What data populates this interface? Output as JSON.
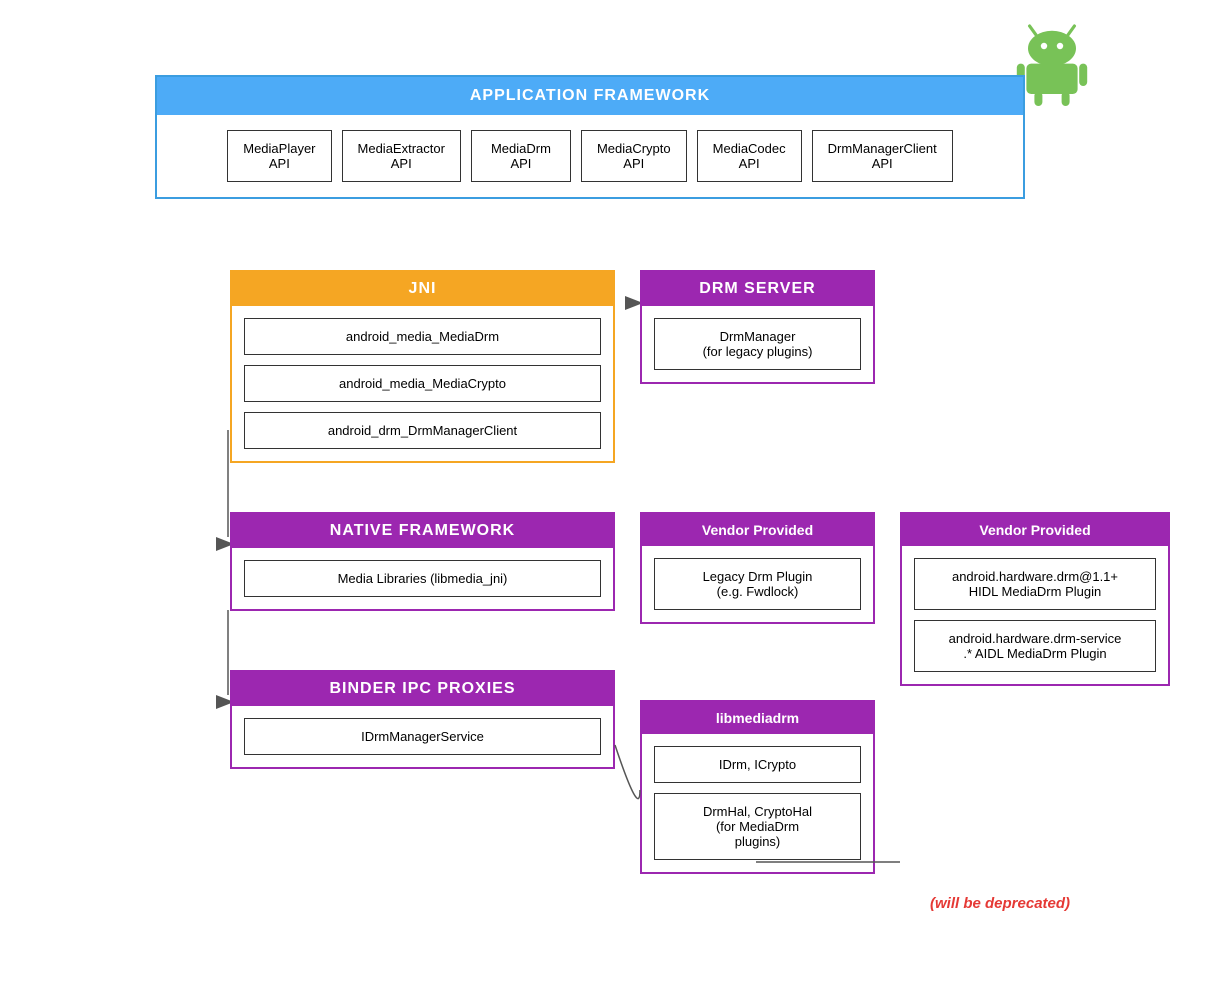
{
  "android_icon": {
    "color_body": "#78c257",
    "color_eye": "#ffffff"
  },
  "app_framework": {
    "header": "APPLICATION FRAMEWORK",
    "apis": [
      {
        "line1": "MediaPlayer",
        "line2": "API"
      },
      {
        "line1": "MediaExtractor",
        "line2": "API"
      },
      {
        "line1": "MediaDrm",
        "line2": "API"
      },
      {
        "line1": "MediaCrypto",
        "line2": "API"
      },
      {
        "line1": "MediaCodec",
        "line2": "API"
      },
      {
        "line1": "DrmManagerClient",
        "line2": "API"
      }
    ]
  },
  "jni": {
    "header": "JNI",
    "items": [
      "android_media_MediaDrm",
      "android_media_MediaCrypto",
      "android_drm_DrmManagerClient"
    ]
  },
  "native_framework": {
    "header": "NATIVE FRAMEWORK",
    "items": [
      "Media Libraries (libmedia_jni)"
    ]
  },
  "binder": {
    "header": "BINDER IPC PROXIES",
    "items": [
      "IDrmManagerService"
    ]
  },
  "drm_server": {
    "header": "DRM SERVER",
    "items": [
      "DrmManager\n(for legacy plugins)"
    ]
  },
  "vendor_left": {
    "header": "Vendor Provided",
    "items": [
      "Legacy Drm Plugin\n(e.g. Fwdlock)"
    ]
  },
  "vendor_right": {
    "header": "Vendor Provided",
    "items": [
      "android.hardware.drm@1.1+\nHIDL MediaDrm Plugin",
      "android.hardware.drm-service\n.* AIDL MediaDrm Plugin"
    ]
  },
  "libmediadrm": {
    "header": "libmediadrm",
    "items": [
      "IDrm, ICrypto",
      "DrmHal, CryptoHal\n(for MediaDrm\nplugins)"
    ]
  },
  "deprecated": {
    "text": "(will be deprecated)"
  }
}
